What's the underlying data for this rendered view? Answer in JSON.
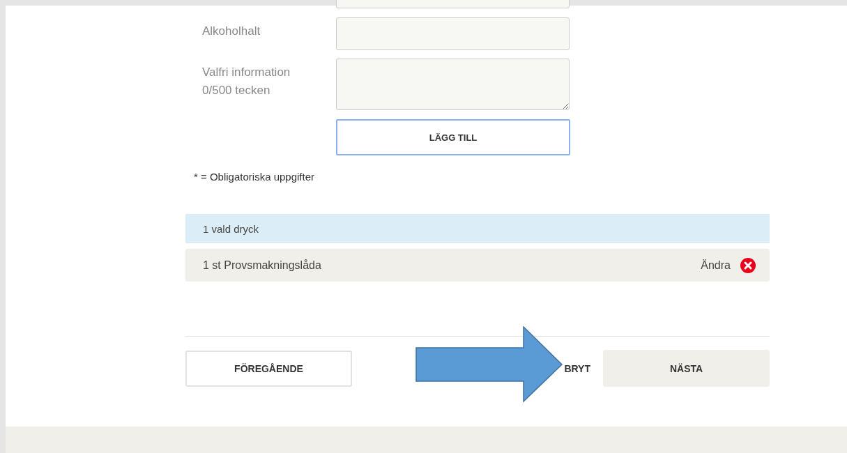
{
  "form": {
    "fields": [
      {
        "label": "Alkoholhalt",
        "kind": "input"
      },
      {
        "label": "Valfri information",
        "counter": "0/500 tecken",
        "kind": "textarea"
      }
    ],
    "add_button": "LÄGG TILL",
    "required_note": "* = Obligatoriska uppgifter"
  },
  "selection": {
    "summary": "1 vald dryck",
    "items": [
      {
        "name": "1 st Provsmakningslåda",
        "edit": "Ändra"
      }
    ]
  },
  "navigation": {
    "previous": "FÖREGÅENDE",
    "cancel": "BRYT",
    "next": "NÄSTA"
  }
}
